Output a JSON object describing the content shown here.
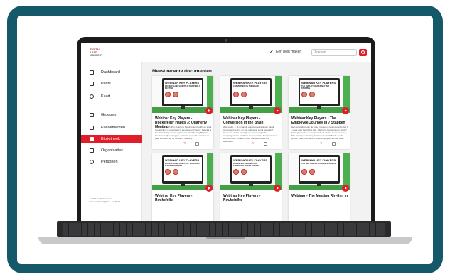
{
  "topbar": {
    "logo_line1": "DIGITAL",
    "logo_line2": "LEAD CONNECT",
    "new_post_label": "Een post maken",
    "search_placeholder": "Zoeken..."
  },
  "sidebar": {
    "items": [
      {
        "label": "Dashboard",
        "icon": "home-icon",
        "active": false
      },
      {
        "label": "Posts",
        "icon": "posts-icon",
        "active": false
      },
      {
        "label": "Kaart",
        "icon": "globe-icon",
        "active": false
      },
      {
        "label": "Groepen",
        "icon": "groups-icon",
        "active": false
      },
      {
        "label": "Evenementen",
        "icon": "calendar-icon",
        "active": false
      },
      {
        "label": "Bibliotheek",
        "icon": "library-icon",
        "active": true
      },
      {
        "label": "Organisaties",
        "icon": "organizations-icon",
        "active": false
      },
      {
        "label": "Personen",
        "icon": "people-icon",
        "active": false
      }
    ],
    "footer_line1": "© 2021 GoToaConnect",
    "footer_line2": "Powered by Big Dash - v4.68.16"
  },
  "main": {
    "title": "Meest recente documenten",
    "cards": [
      {
        "thumb_title": "WEBINAR KEY PLAYERS",
        "thumb_subtitle": "ROCKEFELLER HABITS 3: QUARTERLY MEETING",
        "title": "Webinar Key Players - Rockefeller Habits 3: Quarterly Meeting",
        "description": "The Meeting Rhythm Quarterly Meeting Een bedrijf en strak overlegritme is essentieel in een groeiend bedrijf. Feitelijk is het de hartslag van de organisatie. Het Meeting Rhythm bestaat uit vijf overleggen, waarvan we in dit webinar een paar focussen op de Quarterly Meeting."
      },
      {
        "thumb_title": "WEBINAR KEY PLAYERS",
        "thumb_subtitle": "CONVERSION IN THE BRAIN",
        "title": "Webinar Key Players - Conversion in the Brain",
        "description": "Wist je dat......fit in van de aankoopbeslissingen die de consument neemt, en wat onbewust wordt gemaakt? Conversie is dus eigenlijk een psychologische aangelegenheid. Inzicht in die onbewuste breinprocessen van het brein is daarom voor marketeers dus erg waardevol."
      },
      {
        "thumb_title": "WEBINAR KEY PLAYERS",
        "thumb_subtitle": "THE EMPLOYEE JOURNEY IN 7 STAPPEN",
        "title": "Webinar Key Players - The Employee Journey in 7 Stappen",
        "description": "Het aantrekken van de juiste mensen is tegenwoordig dag 1 . maar daar begint het pas. Want hoe hou je ze een ticket? En beginnen hoe neem je afscheid als het moment daar is. The Employee Journey bestaat uit verschillende touch points, waarin het welzijn al de employee centraal staat."
      },
      {
        "thumb_title": "WEBINAR KEY PLAYERS",
        "thumb_subtitle": "ROCKEFELLER HABITS #2: DATA, KPI'S & DASHBOARDING",
        "title": "Webinar Key Players - Rockefeller",
        "description": ""
      },
      {
        "thumb_title": "WEBINAR KEY PLAYERS",
        "thumb_subtitle": "ROCKEFELLER HABITS #1: PRIORITIES, ROLES & RULES",
        "title": "Webinar Key Players - Rockefeller",
        "description": ""
      },
      {
        "thumb_title": "WEBINAR KEY PLAYERS",
        "thumb_subtitle": "THE MEETING RHYTHM: DE SCALE UP",
        "title": "Webinar - The Meeting Rhythm In",
        "description": ""
      }
    ]
  },
  "colors": {
    "frame": "#14586a",
    "accent": "#e11d2a",
    "thumb_green": "#4caf50"
  }
}
